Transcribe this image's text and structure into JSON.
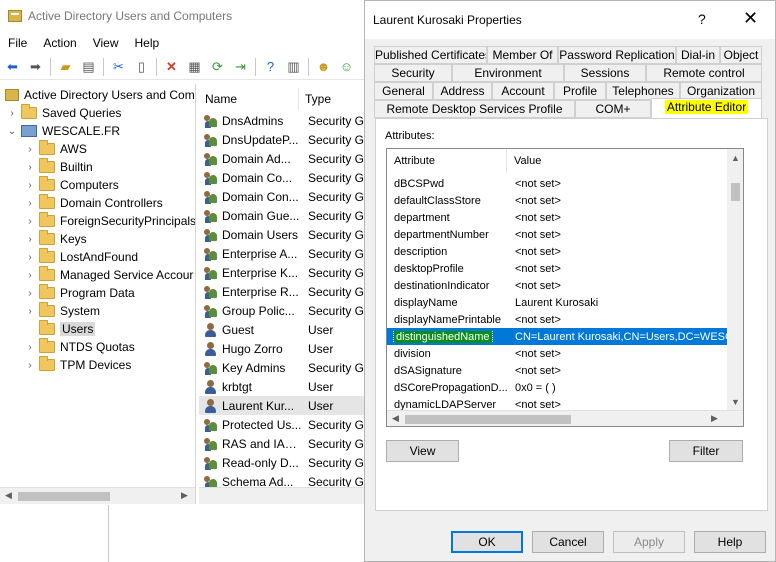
{
  "main_window": {
    "title": "Active Directory Users and Computers",
    "menu": [
      "File",
      "Action",
      "View",
      "Help"
    ],
    "toolbar_icons": [
      "back-icon",
      "forward-icon",
      "up-folder-icon",
      "show-tree-icon",
      "cut-icon",
      "clipboard-icon",
      "delete-icon",
      "properties-icon",
      "refresh-icon",
      "export-icon",
      "help-icon",
      "console-icon",
      "new-user-icon",
      "new-group-icon"
    ]
  },
  "tree": {
    "root": "Active Directory Users and Com",
    "saved_queries": "Saved Queries",
    "domain": "WESCALE.FR",
    "folders": [
      "AWS",
      "Builtin",
      "Computers",
      "Domain Controllers",
      "ForeignSecurityPrincipals",
      "Keys",
      "LostAndFound",
      "Managed Service Accour",
      "Program Data",
      "System",
      "Users",
      "NTDS Quotas",
      "TPM Devices"
    ],
    "selected": "Users"
  },
  "list": {
    "columns": [
      "Name",
      "Type"
    ],
    "rows": [
      {
        "name": "DnsAdmins",
        "type": "Security Gr",
        "kind": "group"
      },
      {
        "name": "DnsUpdateP...",
        "type": "Security Gr",
        "kind": "group"
      },
      {
        "name": "Domain Ad...",
        "type": "Security Gr",
        "kind": "group"
      },
      {
        "name": "Domain Co...",
        "type": "Security Gr",
        "kind": "group"
      },
      {
        "name": "Domain Con...",
        "type": "Security Gr",
        "kind": "group"
      },
      {
        "name": "Domain Gue...",
        "type": "Security Gr",
        "kind": "group"
      },
      {
        "name": "Domain Users",
        "type": "Security Gr",
        "kind": "group"
      },
      {
        "name": "Enterprise A...",
        "type": "Security Gr",
        "kind": "group"
      },
      {
        "name": "Enterprise K...",
        "type": "Security Gr",
        "kind": "group"
      },
      {
        "name": "Enterprise R...",
        "type": "Security Gr",
        "kind": "group"
      },
      {
        "name": "Group Polic...",
        "type": "Security Gr",
        "kind": "group"
      },
      {
        "name": "Guest",
        "type": "User",
        "kind": "user"
      },
      {
        "name": "Hugo Zorro",
        "type": "User",
        "kind": "user"
      },
      {
        "name": "Key Admins",
        "type": "Security Gr",
        "kind": "group"
      },
      {
        "name": "krbtgt",
        "type": "User",
        "kind": "user"
      },
      {
        "name": "Laurent Kur...",
        "type": "User",
        "kind": "user"
      },
      {
        "name": "Protected Us...",
        "type": "Security Gr",
        "kind": "group"
      },
      {
        "name": "RAS and IAS ...",
        "type": "Security Gr",
        "kind": "group"
      },
      {
        "name": "Read-only D...",
        "type": "Security Gr",
        "kind": "group"
      },
      {
        "name": "Schema Ad...",
        "type": "Security Gr",
        "kind": "group"
      }
    ],
    "selected_index": 15
  },
  "dialog": {
    "title": "Laurent Kurosaki Properties",
    "help_glyph": "?",
    "close_glyph": "✕",
    "tabs_row1": [
      "Published Certificates",
      "Member Of",
      "Password Replication",
      "Dial-in",
      "Object"
    ],
    "tabs_row2": [
      "Security",
      "Environment",
      "Sessions",
      "Remote control"
    ],
    "tabs_row3": [
      "General",
      "Address",
      "Account",
      "Profile",
      "Telephones",
      "Organization"
    ],
    "tabs_row4": [
      "Remote Desktop Services Profile",
      "COM+",
      "Attribute Editor"
    ],
    "active_tab": "Attribute Editor",
    "attributes_label": "Attributes:",
    "columns": [
      "Attribute",
      "Value"
    ],
    "attributes": [
      {
        "name": "dBCSPwd",
        "value": "<not set>"
      },
      {
        "name": "defaultClassStore",
        "value": "<not set>"
      },
      {
        "name": "department",
        "value": "<not set>"
      },
      {
        "name": "departmentNumber",
        "value": "<not set>"
      },
      {
        "name": "description",
        "value": "<not set>"
      },
      {
        "name": "desktopProfile",
        "value": "<not set>"
      },
      {
        "name": "destinationIndicator",
        "value": "<not set>"
      },
      {
        "name": "displayName",
        "value": "Laurent Kurosaki"
      },
      {
        "name": "displayNamePrintable",
        "value": "<not set>"
      },
      {
        "name": "distinguishedName",
        "value": "CN=Laurent Kurosaki,CN=Users,DC=WESCA"
      },
      {
        "name": "division",
        "value": "<not set>"
      },
      {
        "name": "dSASignature",
        "value": "<not set>"
      },
      {
        "name": "dSCorePropagationD...",
        "value": "0x0 = ( )"
      },
      {
        "name": "dynamicLDAPServer",
        "value": "<not set>"
      }
    ],
    "selected_attribute_index": 9,
    "view_button": "View",
    "filter_button": "Filter",
    "ok_button": "OK",
    "cancel_button": "Cancel",
    "apply_button": "Apply",
    "help_button": "Help"
  }
}
